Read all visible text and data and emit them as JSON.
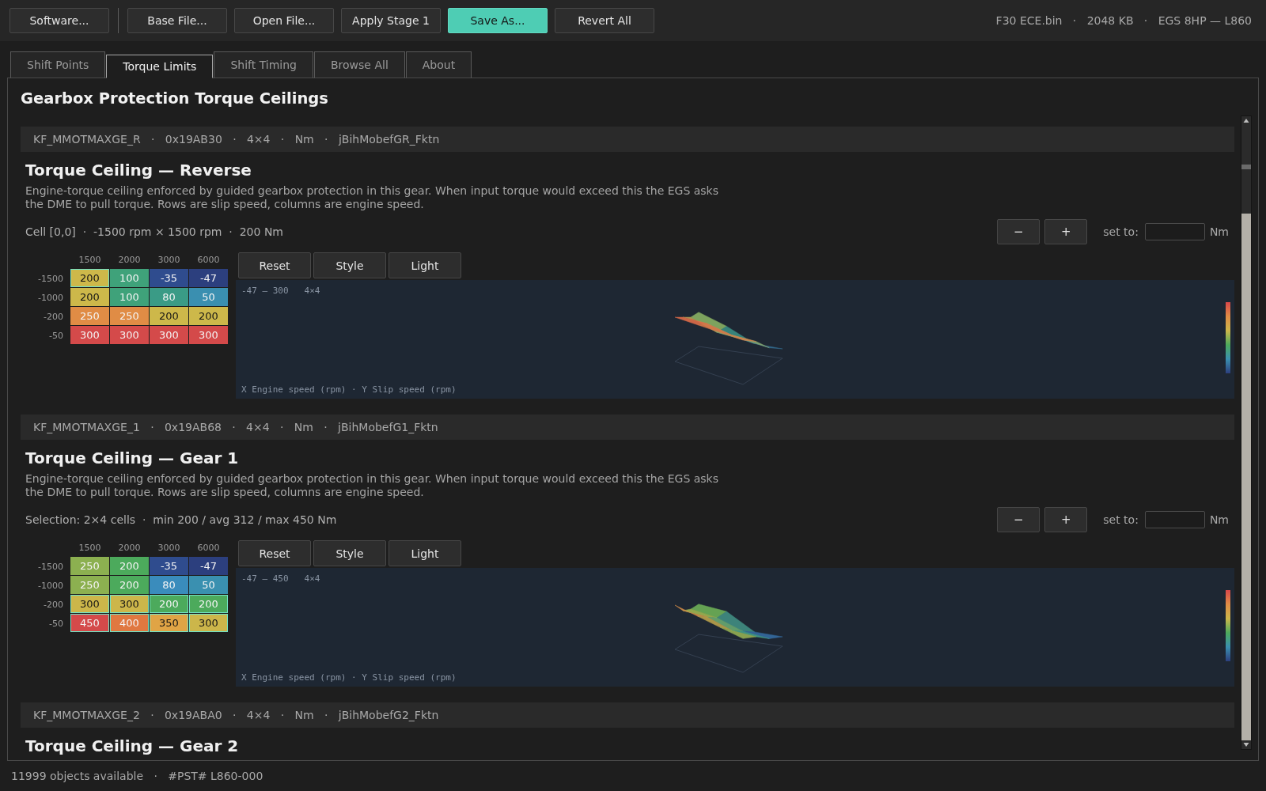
{
  "toolbar": {
    "button_groups": [
      {
        "buttons": [
          {
            "label": "Software...",
            "kind": "normal"
          }
        ]
      },
      {
        "buttons": [
          {
            "label": "Base File...",
            "kind": "normal"
          },
          {
            "label": "Open File...",
            "kind": "normal"
          },
          {
            "label": "Apply Stage 1",
            "kind": "normal"
          },
          {
            "label": "Save As...",
            "kind": "primary"
          },
          {
            "label": "Revert All",
            "kind": "normal"
          }
        ]
      }
    ],
    "file_info": "F30 ECE.bin   ·   2048 KB   ·   EGS 8HP — L860"
  },
  "tabs": [
    {
      "label": "Shift Points",
      "selected": false
    },
    {
      "label": "Torque Limits",
      "selected": true
    },
    {
      "label": "Shift Timing",
      "selected": false
    },
    {
      "label": "Browse All",
      "selected": false
    },
    {
      "label": "About",
      "selected": false
    }
  ],
  "panel": {
    "heading": "Gearbox Protection Torque Ceilings",
    "maps": [
      {
        "header": "KF_MMOTMAXGE_R   ·   0x19AB30   ·   4×4   ·   Nm   ·   jBihMobefGR_Fktn",
        "title": "Torque Ceiling — Reverse",
        "description": "Engine-torque ceiling enforced by guided gearbox protection in this gear. When input torque would exceed this the EGS asks the DME to pull torque. Rows are slip speed, columns are engine speed.",
        "info": "Cell [0,0]  ·  -1500 rpm × 1500 rpm  ·  200 Nm",
        "step_buttons": [
          "−",
          "+"
        ],
        "set_label": "set to:",
        "unit": "Nm",
        "buttons": [
          "Reset",
          "Style",
          "Light"
        ],
        "table": {
          "columns": [
            "1500",
            "2000",
            "3000",
            "6000"
          ],
          "rows": [
            {
              "label": "-1500",
              "cells": [
                {
                  "value": "200",
                  "color": "#cdb84a",
                  "selected": true
                },
                {
                  "value": "100",
                  "color": "#3fa27a",
                  "selected": false
                },
                {
                  "value": "-35",
                  "color": "#2f4c8e",
                  "selected": false
                },
                {
                  "value": "-47",
                  "color": "#2c3f7e",
                  "selected": false
                }
              ]
            },
            {
              "label": "-1000",
              "cells": [
                {
                  "value": "200",
                  "color": "#cdb84a",
                  "selected": false
                },
                {
                  "value": "100",
                  "color": "#3fa27a",
                  "selected": false
                },
                {
                  "value": "80",
                  "color": "#3a9b86",
                  "selected": false
                },
                {
                  "value": "50",
                  "color": "#3a8fb0",
                  "selected": false
                }
              ]
            },
            {
              "label": "-200",
              "cells": [
                {
                  "value": "250",
                  "color": "#e08c45",
                  "selected": false
                },
                {
                  "value": "250",
                  "color": "#e08c45",
                  "selected": false
                },
                {
                  "value": "200",
                  "color": "#cdb84a",
                  "selected": false
                },
                {
                  "value": "200",
                  "color": "#cdb84a",
                  "selected": false
                }
              ]
            },
            {
              "label": "-50",
              "cells": [
                {
                  "value": "300",
                  "color": "#d44a4a",
                  "selected": false
                },
                {
                  "value": "300",
                  "color": "#d44a4a",
                  "selected": false
                },
                {
                  "value": "300",
                  "color": "#d44a4a",
                  "selected": false
                },
                {
                  "value": "300",
                  "color": "#d44a4a",
                  "selected": false
                }
              ]
            }
          ]
        },
        "chart": {
          "range": "-47 — 300",
          "size": "4×4",
          "caption": "X Engine speed (rpm) · Y Slip speed (rpm)"
        }
      },
      {
        "header": "KF_MMOTMAXGE_1   ·   0x19AB68   ·   4×4   ·   Nm   ·   jBihMobefG1_Fktn",
        "title": "Torque Ceiling — Gear 1",
        "description": "Engine-torque ceiling enforced by guided gearbox protection in this gear. When input torque would exceed this the EGS asks the DME to pull torque. Rows are slip speed, columns are engine speed.",
        "info": "Selection: 2×4 cells  ·  min 200 / avg 312 / max 450 Nm",
        "step_buttons": [
          "−",
          "+"
        ],
        "set_label": "set to:",
        "unit": "Nm",
        "buttons": [
          "Reset",
          "Style",
          "Light"
        ],
        "table": {
          "columns": [
            "1500",
            "2000",
            "3000",
            "6000"
          ],
          "rows": [
            {
              "label": "-1500",
              "cells": [
                {
                  "value": "250",
                  "color": "#8cb050",
                  "selected": false
                },
                {
                  "value": "200",
                  "color": "#4caa5c",
                  "selected": false
                },
                {
                  "value": "-35",
                  "color": "#2f4c8e",
                  "selected": false
                },
                {
                  "value": "-47",
                  "color": "#2c3f7e",
                  "selected": false
                }
              ]
            },
            {
              "label": "-1000",
              "cells": [
                {
                  "value": "250",
                  "color": "#8cb050",
                  "selected": false
                },
                {
                  "value": "200",
                  "color": "#4caa5c",
                  "selected": false
                },
                {
                  "value": "80",
                  "color": "#3a8cbc",
                  "selected": false
                },
                {
                  "value": "50",
                  "color": "#3a90b0",
                  "selected": false
                }
              ]
            },
            {
              "label": "-200",
              "cells": [
                {
                  "value": "300",
                  "color": "#ccb64a",
                  "selected": true
                },
                {
                  "value": "300",
                  "color": "#ccb64a",
                  "selected": true
                },
                {
                  "value": "200",
                  "color": "#4caa5c",
                  "selected": true
                },
                {
                  "value": "200",
                  "color": "#4caa5c",
                  "selected": true
                }
              ]
            },
            {
              "label": "-50",
              "cells": [
                {
                  "value": "450",
                  "color": "#d44a4a",
                  "selected": true
                },
                {
                  "value": "400",
                  "color": "#e07840",
                  "selected": true
                },
                {
                  "value": "350",
                  "color": "#e0a445",
                  "selected": true
                },
                {
                  "value": "300",
                  "color": "#ccb64a",
                  "selected": true
                }
              ]
            }
          ]
        },
        "chart": {
          "range": "-47 — 450",
          "size": "4×4",
          "caption": "X Engine speed (rpm) · Y Slip speed (rpm)"
        }
      },
      {
        "header": "KF_MMOTMAXGE_2   ·   0x19ABA0   ·   4×4   ·   Nm   ·   jBihMobefG2_Fktn",
        "title": "Torque Ceiling — Gear 2"
      }
    ]
  },
  "status_bar": "11999 objects available   ·   #PST# L860-000"
}
